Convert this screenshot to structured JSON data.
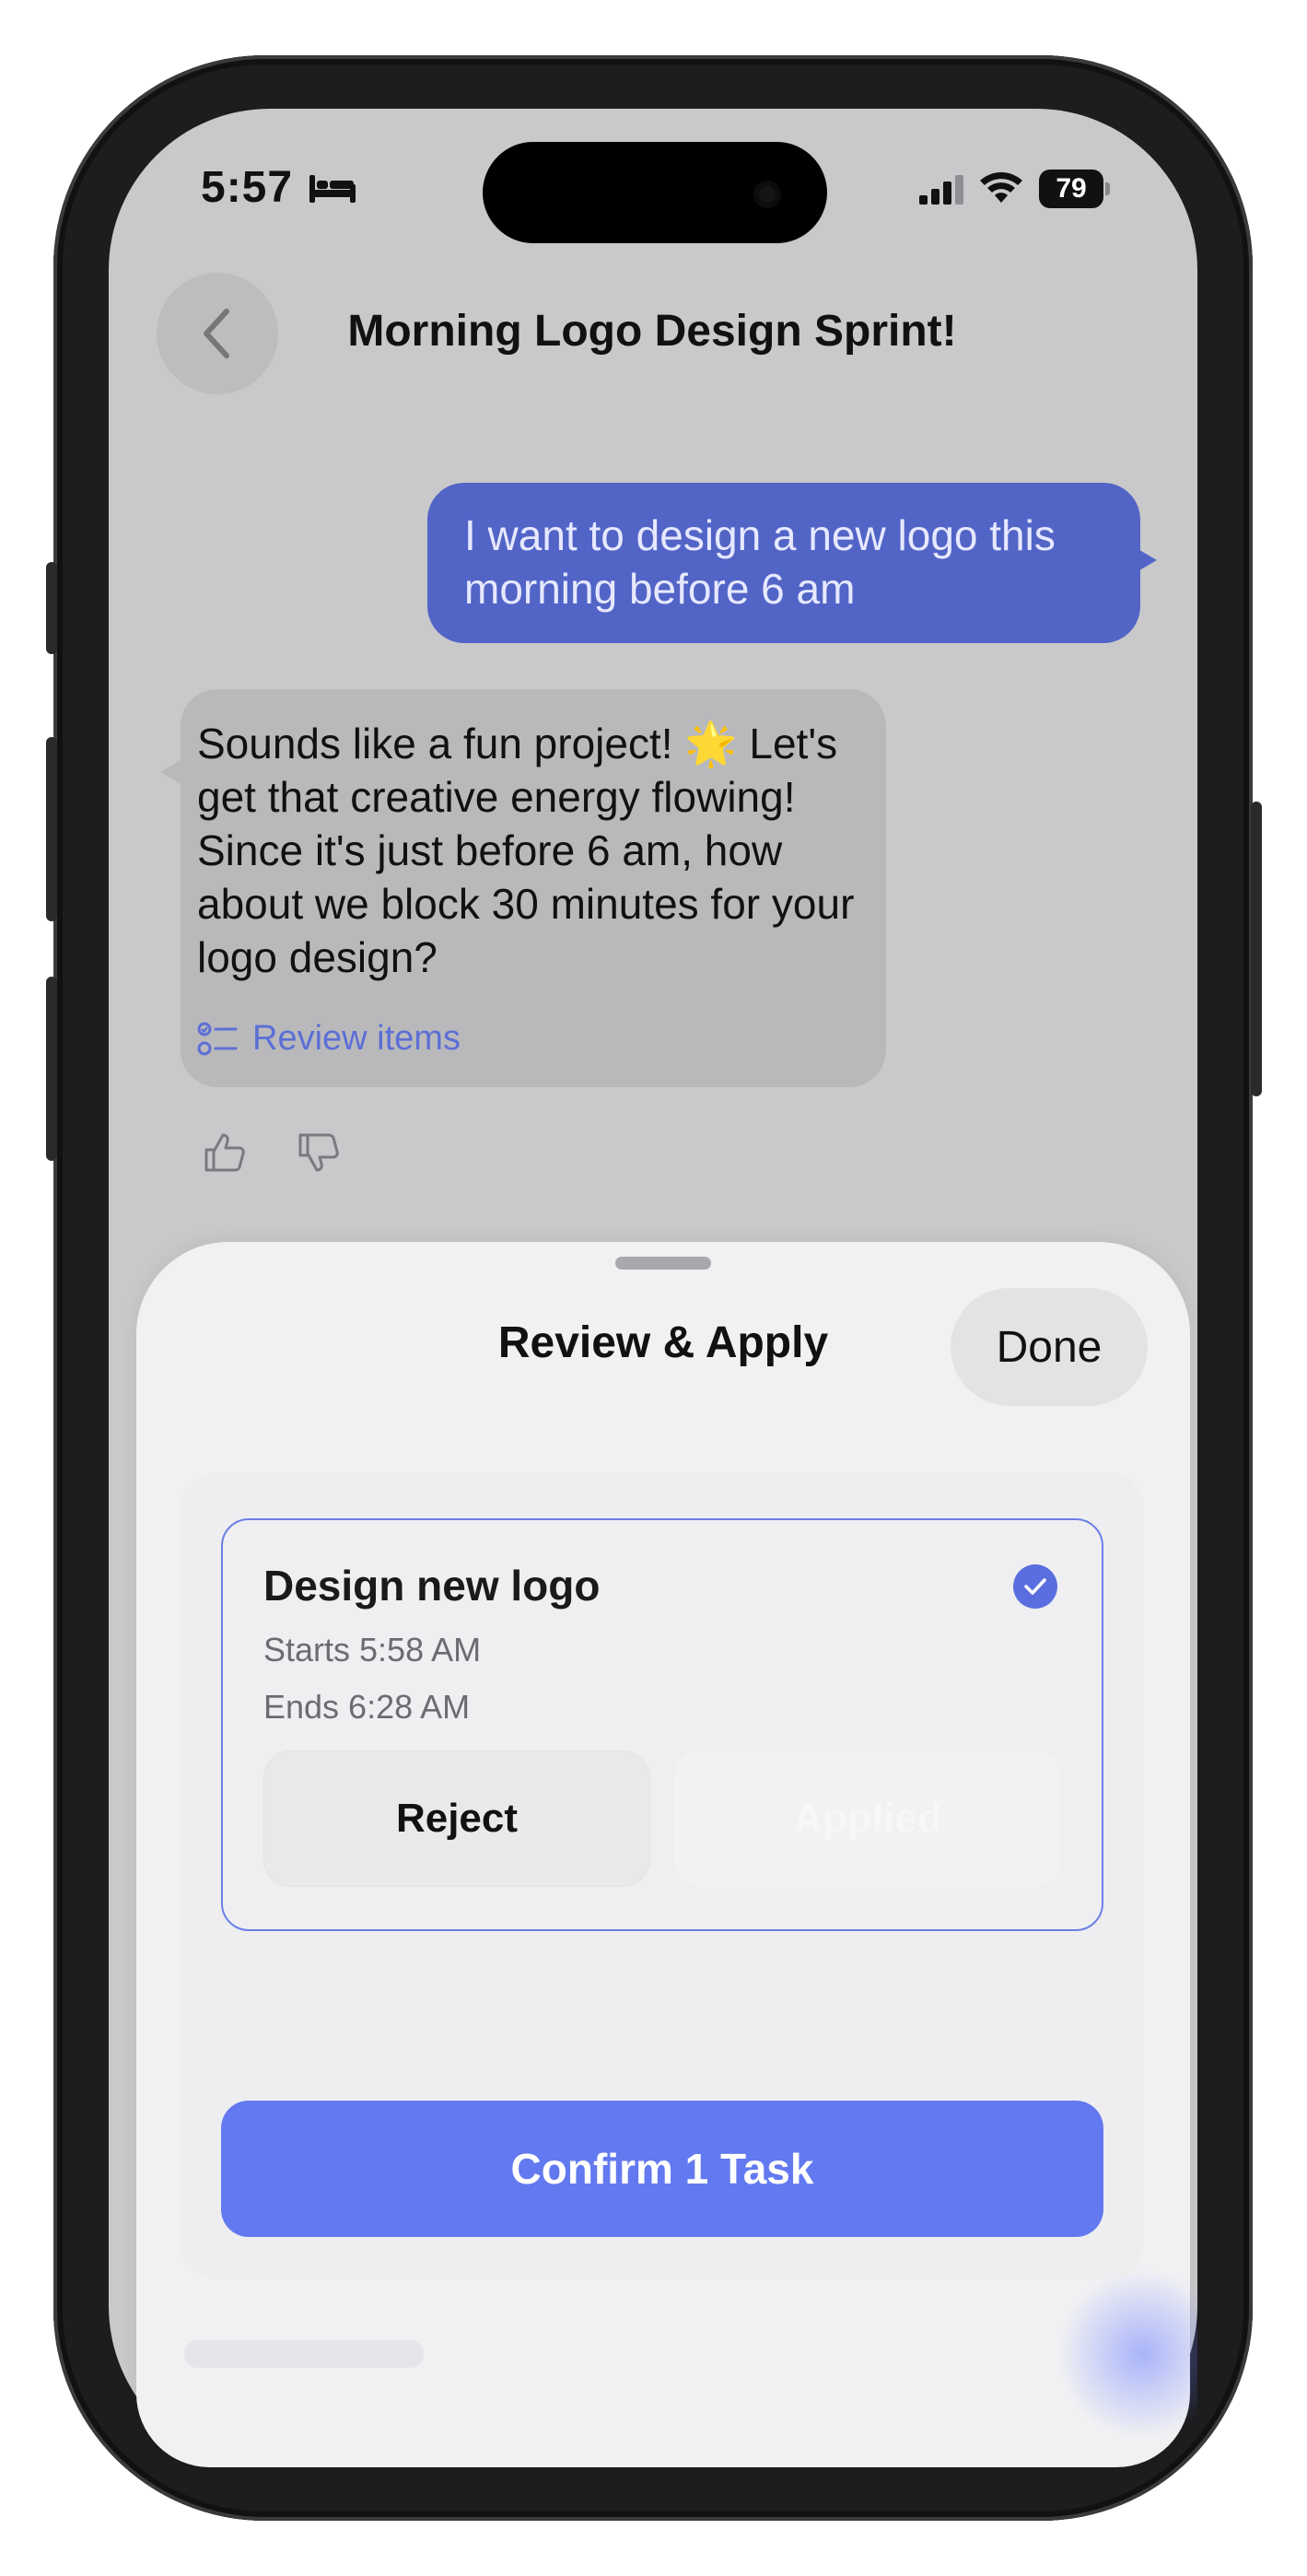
{
  "status_bar": {
    "time": "5:57",
    "battery": "79"
  },
  "header": {
    "title": "Morning Logo Design Sprint!"
  },
  "chat": {
    "user_message": "I want to design a new logo this morning before 6 am",
    "bot_message": "Sounds like a fun project! 🌟 Let's get that creative energy flowing! Since it's just before 6 am, how about we block 30 minutes for your logo design?",
    "review_link": "Review items"
  },
  "sheet": {
    "title": "Review & Apply",
    "done_label": "Done",
    "task": {
      "title": "Design new logo",
      "starts": "Starts 5:58 AM",
      "ends": "Ends 6:28 AM",
      "reject_label": "Reject",
      "applied_label": "Applied"
    },
    "confirm_label": "Confirm 1 Task"
  },
  "colors": {
    "accent": "#6379f0",
    "user_bubble": "#5264c6",
    "link": "#5c6fd6"
  }
}
